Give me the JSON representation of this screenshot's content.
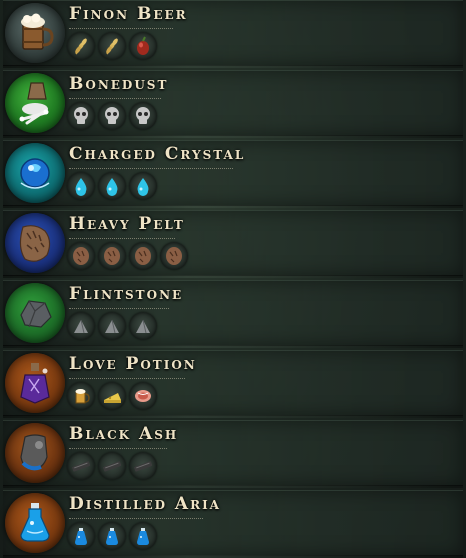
{
  "recipes": [
    {
      "name": "Finon Beer",
      "icon": "beer-mug-icon",
      "ingredients": [
        "wheat-icon",
        "wheat-icon",
        "red-berry-icon"
      ]
    },
    {
      "name": "Bonedust",
      "icon": "mortar-pestle-bones-icon",
      "ingredients": [
        "skull-icon",
        "skull-icon",
        "skull-icon"
      ]
    },
    {
      "name": "Charged Crystal",
      "icon": "blue-crystal-orb-icon",
      "ingredients": [
        "water-drop-icon",
        "water-drop-icon",
        "water-drop-icon"
      ]
    },
    {
      "name": "Heavy Pelt",
      "icon": "fur-pelt-icon",
      "ingredients": [
        "hide-icon",
        "hide-icon",
        "hide-icon",
        "hide-icon"
      ]
    },
    {
      "name": "Flintstone",
      "icon": "flint-rock-icon",
      "ingredients": [
        "stone-pile-icon",
        "stone-pile-icon",
        "stone-pile-icon"
      ]
    },
    {
      "name": "Love Potion",
      "icon": "purple-potion-icon",
      "ingredients": [
        "beer-mug-icon",
        "cheese-icon",
        "meat-icon"
      ]
    },
    {
      "name": "Black Ash",
      "icon": "ash-sack-icon",
      "ingredients": [
        "charcoal-log-icon",
        "charcoal-log-icon",
        "charcoal-log-icon"
      ]
    },
    {
      "name": "Distilled Aria",
      "icon": "blue-flask-icon",
      "ingredients": [
        "blue-vial-icon",
        "blue-vial-icon",
        "blue-vial-icon"
      ]
    }
  ]
}
